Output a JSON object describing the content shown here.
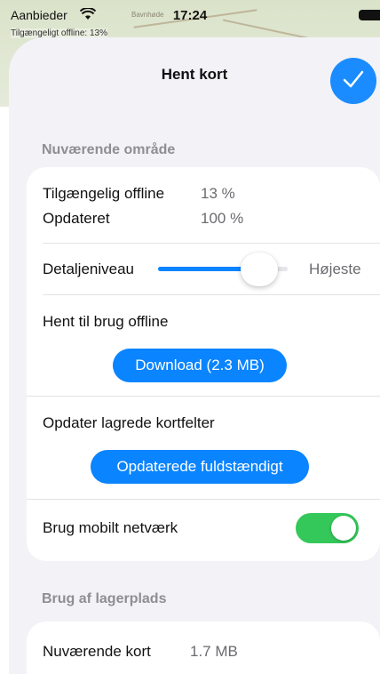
{
  "status_bar": {
    "carrier": "Aanbieder",
    "time": "17:24"
  },
  "map": {
    "offline_label": "Tilgængeligt offline: 13%",
    "town_label": "Bavnhøde"
  },
  "sheet": {
    "title": "Hent kort",
    "done_icon": "checkmark-icon"
  },
  "current_area": {
    "header": "Nuværende område",
    "available_offline_label": "Tilgængelig offline",
    "available_offline_value": "13 %",
    "updated_label": "Opdateret",
    "updated_value": "100 %",
    "detail_label": "Detaljeniveau",
    "detail_level_value": "Højeste",
    "detail_level_fraction": 0.78,
    "download_for_offline_label": "Hent til brug offline",
    "download_button": "Download (2.3 MB)",
    "update_tiles_label": "Opdater lagrede kortfelter",
    "update_button": "Opdaterede fuldstændigt",
    "mobile_network_label": "Brug mobilt netværk",
    "mobile_network_enabled": true
  },
  "storage": {
    "header": "Brug af lagerplads",
    "current_maps_label": "Nuværende kort",
    "current_maps_value": "1.7 MB"
  },
  "colors": {
    "accent": "#0a84ff",
    "toggle_on": "#34c759"
  }
}
